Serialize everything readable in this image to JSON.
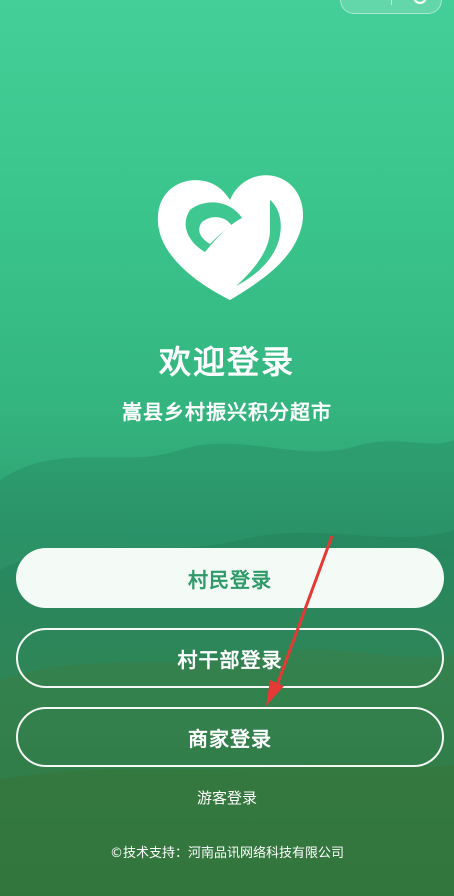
{
  "title": "欢迎登录",
  "subtitle": "嵩县乡村振兴积分超市",
  "buttons": {
    "villager": "村民登录",
    "cadre": "村干部登录",
    "merchant": "商家登录"
  },
  "guest_login": "游客登录",
  "footer": "©技术支持：河南品讯网络科技有限公司",
  "colors": {
    "accent": "#2d9a68",
    "background": "#3fc791",
    "annotation_arrow": "#e53935"
  }
}
